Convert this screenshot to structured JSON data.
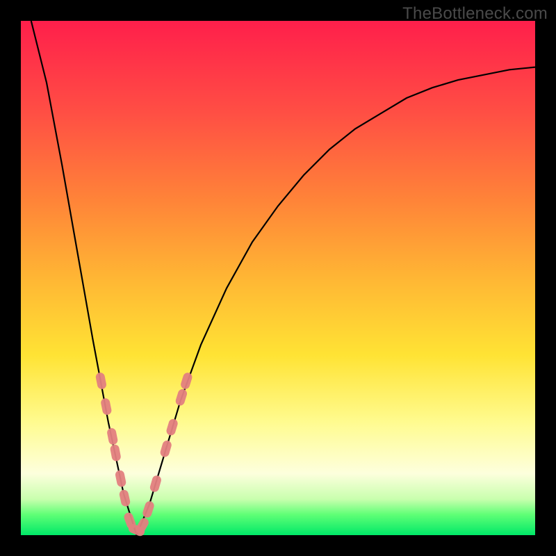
{
  "watermark": "TheBottleneck.com",
  "colors": {
    "curve": "#000000",
    "markers": "#e38080",
    "frame": "#000000"
  },
  "chart_data": {
    "type": "line",
    "title": "",
    "xlabel": "",
    "ylabel": "",
    "xlim": [
      0,
      1
    ],
    "ylim": [
      0,
      1
    ],
    "grid": false,
    "legend": false,
    "note": "Axes are unlabeled; values are fractional positions read from the image (x: 0=left, 1=right of plot; y: 0=bottom, 1=top of plot).",
    "x_min_of_curve": 0.225,
    "series": [
      {
        "name": "bottleneck-curve",
        "x": [
          0.02,
          0.05,
          0.08,
          0.11,
          0.14,
          0.17,
          0.2,
          0.225,
          0.25,
          0.28,
          0.31,
          0.35,
          0.4,
          0.45,
          0.5,
          0.55,
          0.6,
          0.65,
          0.7,
          0.75,
          0.8,
          0.85,
          0.9,
          0.95,
          1.0
        ],
        "y": [
          1.0,
          0.88,
          0.72,
          0.55,
          0.38,
          0.22,
          0.08,
          0.0,
          0.06,
          0.16,
          0.26,
          0.37,
          0.48,
          0.57,
          0.64,
          0.7,
          0.75,
          0.79,
          0.82,
          0.85,
          0.87,
          0.885,
          0.895,
          0.905,
          0.91
        ]
      }
    ],
    "markers": {
      "name": "highlighted-segments",
      "shape": "rounded-rect",
      "color": "#e38080",
      "points": [
        {
          "x": 0.156,
          "y": 0.3
        },
        {
          "x": 0.166,
          "y": 0.25
        },
        {
          "x": 0.178,
          "y": 0.192
        },
        {
          "x": 0.184,
          "y": 0.16
        },
        {
          "x": 0.194,
          "y": 0.11
        },
        {
          "x": 0.202,
          "y": 0.072
        },
        {
          "x": 0.212,
          "y": 0.028
        },
        {
          "x": 0.225,
          "y": 0.01
        },
        {
          "x": 0.236,
          "y": 0.018
        },
        {
          "x": 0.248,
          "y": 0.05
        },
        {
          "x": 0.262,
          "y": 0.1
        },
        {
          "x": 0.282,
          "y": 0.168
        },
        {
          "x": 0.294,
          "y": 0.21
        },
        {
          "x": 0.312,
          "y": 0.268
        },
        {
          "x": 0.322,
          "y": 0.3
        }
      ]
    }
  }
}
